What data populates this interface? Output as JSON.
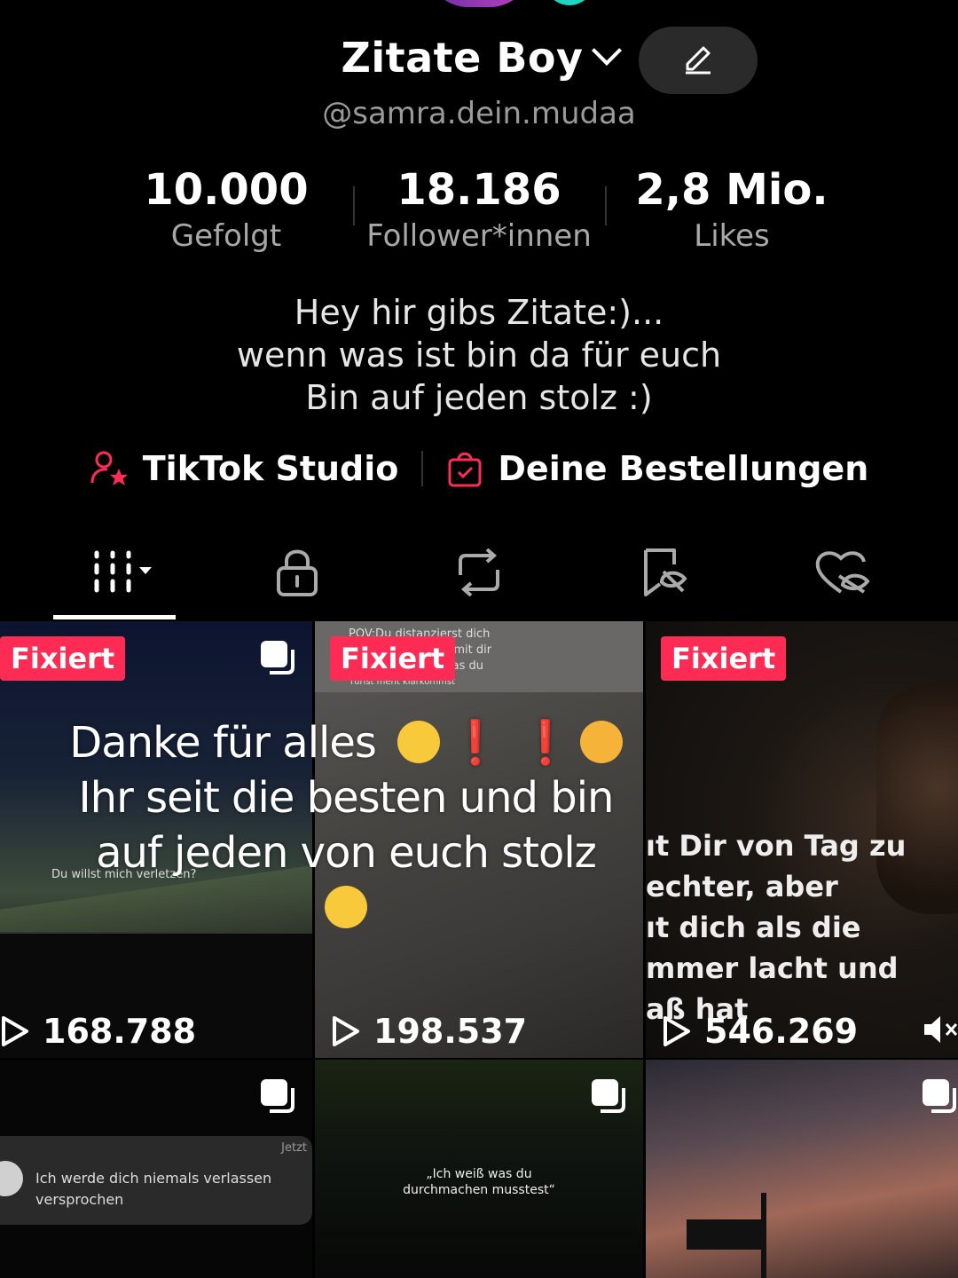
{
  "profile": {
    "name": "Zitate Boy",
    "handle": "@samra.dein.mudaa"
  },
  "stats": [
    {
      "value": "10.000",
      "label": "Gefolgt"
    },
    {
      "value": "18.186",
      "label": "Follower*innen"
    },
    {
      "value": "2,8 Mio.",
      "label": "Likes"
    }
  ],
  "bio": {
    "line1": "Hey  hir gibs Zitate:)...",
    "line2": "wenn was ist bin da für euch",
    "line3": "Bin auf jeden stolz :)"
  },
  "links": {
    "studio": "TikTok Studio",
    "orders": "Deine Bestellungen"
  },
  "tabs": [
    "videos-grid-icon",
    "lock-icon",
    "repost-icon",
    "saved-icon",
    "liked-icon"
  ],
  "pinned_label": "Fixiert",
  "overlay": {
    "line1": "Danke für alles",
    "line2": "Ihr  seit die besten und bin",
    "line3": "auf jeden von euch stolz",
    "bang": "❗"
  },
  "videos": [
    {
      "views": "168.788",
      "caption": "Du willst mich verletzen?"
    },
    {
      "views": "198.537",
      "caption_lines": [
        "POV:Du distanzierst dich",
        "u mit dir",
        "was du",
        "rurist ment kiarkommst"
      ]
    },
    {
      "views": "546.269",
      "caption_lines": [
        "ıt Dir von Tag zu",
        "echter, aber",
        "ıt dich als die",
        "mmer lacht und",
        "aß hat"
      ]
    },
    {
      "notif_time": "Jetzt",
      "notif_lines": [
        "Ich werde dich niemals verlassen",
        "versprochen"
      ]
    },
    {
      "caption_lines": [
        "„Ich weiß was du",
        "durchmachen musstest“"
      ]
    },
    {}
  ],
  "colors": {
    "accent": "#fe2c55",
    "background": "#000000"
  }
}
